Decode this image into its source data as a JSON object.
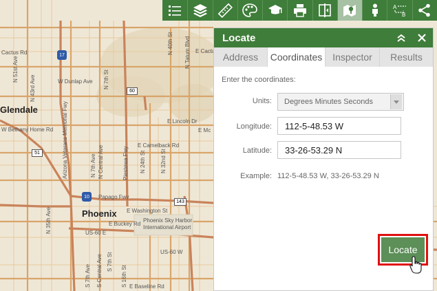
{
  "toolbar": {
    "tools": [
      {
        "icon": "layer-list-icon"
      },
      {
        "icon": "layers-icon"
      },
      {
        "icon": "measure-ruler-icon"
      },
      {
        "icon": "basemap-palette-icon"
      },
      {
        "icon": "education-cap-icon"
      },
      {
        "icon": "print-icon"
      },
      {
        "icon": "swipe-icon"
      },
      {
        "icon": "locate-map-icon",
        "active": true
      },
      {
        "icon": "person-icon"
      },
      {
        "icon": "directions-ab-icon"
      },
      {
        "icon": "share-icon"
      }
    ],
    "colors": {
      "bar": "#3f7d3a",
      "active": "#a6c1a3"
    }
  },
  "map": {
    "cities": [
      "Glendale",
      "Phoenix"
    ],
    "streets": [
      "W Dunlap Ave",
      "W Bethany Home Rd",
      "E Camelback Rd",
      "E Lincoln Dr",
      "E Washington St",
      "E Buckey Rd",
      "E Baseline Rd",
      "Papago Fwy",
      "N 35th Ave",
      "N 7th Ave",
      "N 7th St",
      "N 24th St",
      "N 32nd St",
      "N Central Ave",
      "Piestewa Fwy",
      "S Central Ave",
      "S 7th Ave",
      "S 16th St",
      "S 7th St",
      "Phoenix Sky Harbor International Airport",
      "US-60 E",
      "US-60 W",
      "I-10",
      "I-17",
      "51",
      "60",
      "143",
      "Cactus Rd",
      "E Cactus",
      "N 40th St",
      "N Tatum Blvd",
      "E Mc",
      "N 51st Ave",
      "N 43rd Ave",
      "Arizona Veterans Memorial Fwy",
      "10",
      "17"
    ]
  },
  "panel": {
    "title": "Locate",
    "tabs": [
      {
        "label": "Address",
        "active": false
      },
      {
        "label": "Coordinates",
        "active": true
      },
      {
        "label": "Inspector",
        "active": false
      },
      {
        "label": "Results",
        "active": false
      }
    ],
    "intro": "Enter the coordinates:",
    "units_label": "Units:",
    "units_value": "Degrees Minutes Seconds",
    "longitude_label": "Longitude:",
    "longitude_value": "112-5-48.53 W",
    "latitude_label": "Latitude:",
    "latitude_value": "33-26-53.29 N",
    "example_label": "Example:",
    "example_value": "112-5-48.53 W, 33-26-53.29 N",
    "locate_button": "Locate",
    "colors": {
      "header": "#3f7d3a",
      "button": "#5d8f58",
      "highlight": "#e01010"
    }
  }
}
